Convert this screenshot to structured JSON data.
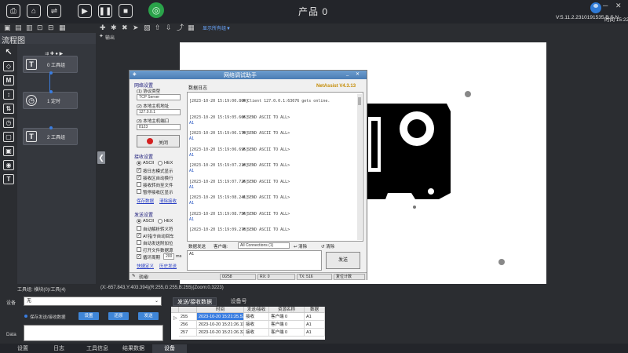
{
  "topbar": {
    "product_title": "产品  0",
    "version": "V:5.11.2.2310191535.B.S.N",
    "time": "时间 15:22",
    "user_icon": "user-icon",
    "buttons": [
      "folder-open-icon",
      "home-icon",
      "link-icon",
      "play-icon",
      "pause-icon",
      "stop-icon",
      "app-logo-icon"
    ],
    "window_controls": [
      "minimize",
      "maximize",
      "close"
    ]
  },
  "subbar": {
    "display_mode": "显示所有组▼",
    "icons": [
      "save-icon",
      "save-as-icon",
      "clipboard-icon",
      "lock-icon",
      "unlock-icon",
      "add-icon",
      "settings-icon",
      "close-icon",
      "cursor-icon",
      "document-icon",
      "up-icon",
      "down-icon",
      "export-icon",
      "grid-icon",
      "zoom-icon"
    ]
  },
  "left_panel": {
    "tab": "流程图",
    "nodes": [
      {
        "label": "0 工具组"
      },
      {
        "label": "1 定时"
      },
      {
        "label": "2 工具组"
      }
    ],
    "tools": [
      "cursor",
      "diamond",
      "M",
      "updown",
      "sort",
      "clock",
      "box",
      "box2",
      "camera",
      "T"
    ],
    "status": "工具组: 横块(0)/工具(4)"
  },
  "output": {
    "label": "输出",
    "coords": "(X:-657.843,Y:403.394)(R:255,G:255,B:255)(Zoom:0.3223)"
  },
  "netassist": {
    "title": "网络调试助手",
    "brand": "NetAssist V4.3.13",
    "net_settings": "网络设置",
    "protocol_label": "(1) 协议类型",
    "protocol_value": "TCP Server",
    "host_label": "(2) 本地主机地址",
    "host_value": "127.0.0.1",
    "port_label": "(3) 本地主机端口",
    "port_value": "8123",
    "close_button": "关闭",
    "recv_settings": "接收设置",
    "ascii": "ASCII",
    "hex": "HEX",
    "recv_options": [
      "按日志模式显示",
      "接收区自动换行",
      "接收转向至文件",
      "暂停接收区显示"
    ],
    "recv_options_checked": [
      true,
      true,
      false,
      false
    ],
    "save_data": "保存数据",
    "clear_recv": "清除接收",
    "send_settings": "发送设置",
    "send_options": [
      "自动解析转义符",
      "AT指令自动回车",
      "自动发送附加位",
      "打开文件数据源",
      "循环周期"
    ],
    "send_options_checked": [
      false,
      true,
      false,
      false,
      true
    ],
    "cycle_value": "200",
    "cycle_unit": "ms",
    "shortcut_def": "快捷定义",
    "history_send": "历史发送",
    "log_tab": "数据日志",
    "log": [
      {
        "time": "[2023-10-20 15:19:00.809]",
        "msg": "# Client 127.0.0.1:63676 gets online.",
        "payload": ""
      },
      {
        "time": "[2023-10-20 15:19:05.666]",
        "msg": "# SEND ASCII TO ALL>",
        "payload": "A1"
      },
      {
        "time": "[2023-10-20 15:19:06.179]",
        "msg": "# SEND ASCII TO ALL>",
        "payload": "A1"
      },
      {
        "time": "[2023-10-20 15:19:06.695]",
        "msg": "# SEND ASCII TO ALL>",
        "payload": "A1"
      },
      {
        "time": "[2023-10-20 15:19:07.210]",
        "msg": "# SEND ASCII TO ALL>",
        "payload": "A1"
      },
      {
        "time": "[2023-10-20 15:19:07.726]",
        "msg": "# SEND ASCII TO ALL>",
        "payload": "A1"
      },
      {
        "time": "[2023-10-20 15:19:08.241]",
        "msg": "# SEND ASCII TO ALL>",
        "payload": "A1"
      },
      {
        "time": "[2023-10-20 15:19:08.756]",
        "msg": "# SEND ASCII TO ALL>",
        "payload": "A1"
      },
      {
        "time": "[2023-10-20 15:19:09.273]",
        "msg": "# SEND ASCII TO ALL>",
        "payload": ""
      }
    ],
    "send_label": "数据发送",
    "client_label": "客户端:",
    "client_value": "All Connections (1)",
    "clear_btn": "↩ 清除",
    "clear_btn2": "↺ 清除",
    "send_text": "A1",
    "send_button": "发送",
    "status_ready": "就绪!",
    "status_count": "0/258",
    "status_rx": "RX: 0",
    "status_tx": "TX: 516",
    "status_reset": "复位计数"
  },
  "bottom": {
    "device_label": "设备",
    "device_value": "无",
    "save_label": "保存发送/接收数据",
    "buttons": [
      "设置",
      "还原",
      "发送"
    ],
    "data_label": "Data",
    "tabs": [
      "发送/接收数据",
      "设备号"
    ],
    "table": {
      "headers": [
        "",
        "时间",
        "发送/接收",
        "资源名称",
        "数据"
      ],
      "rows": [
        {
          "index": "255",
          "time": "2023-10-20 15:21:25.528",
          "dir": "接收",
          "res": "客户端 0",
          "data": "A1"
        },
        {
          "index": "256",
          "time": "2023-10-20 15:21:26.117",
          "dir": "接收",
          "res": "客户端 0",
          "data": "A1"
        },
        {
          "index": "257",
          "time": "2023-10-20 15:21:26.327",
          "dir": "接收",
          "res": "客户端 0",
          "data": "A1"
        }
      ]
    },
    "bottom_tabs": [
      "设置",
      "日志",
      "工具信息",
      "结果数据",
      "设备"
    ]
  },
  "colors": {
    "accent": "#3a7de0",
    "green": "#2aa34a",
    "bg": "#2b2d31"
  }
}
